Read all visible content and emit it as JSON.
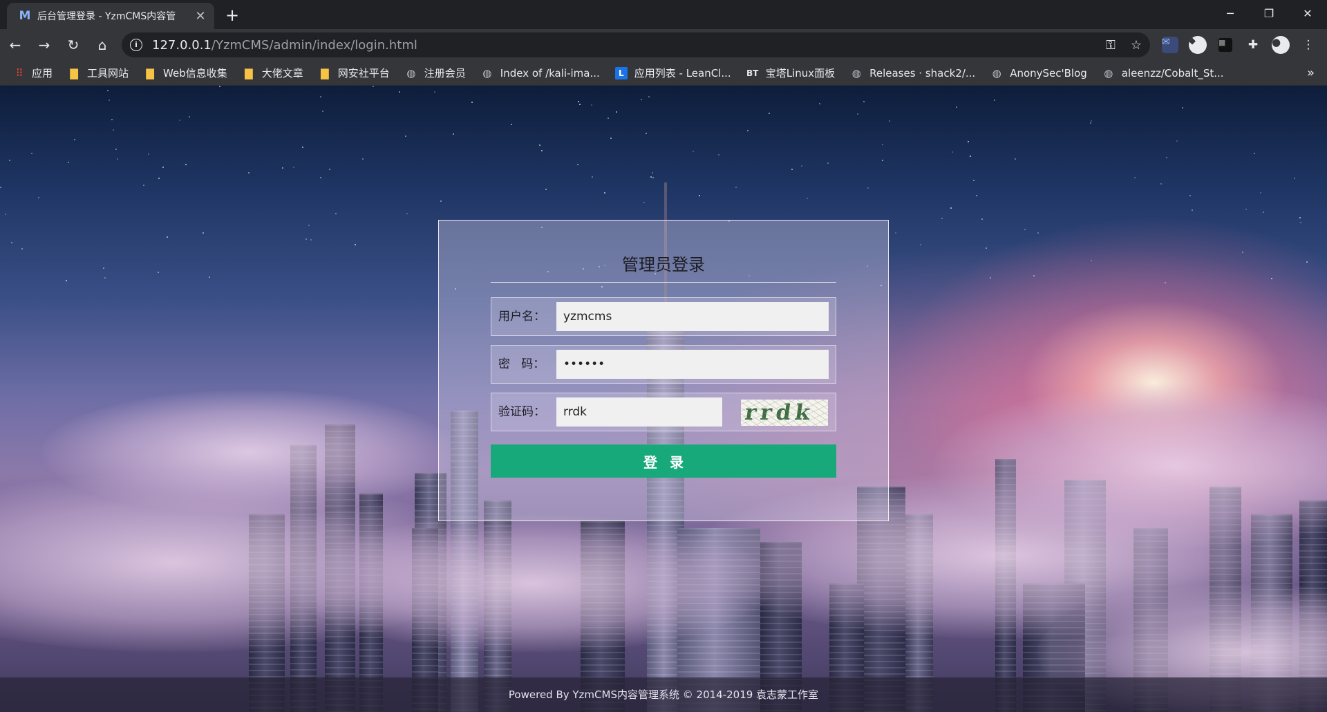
{
  "browser": {
    "tab_favicon": "M",
    "tab_title": "后台管理登录 - YzmCMS内容管",
    "tab_close": "✕",
    "new_tab": "+",
    "url_host": "127.0.0.1",
    "url_path": "/YzmCMS/admin/index/login.html",
    "window_controls": [
      "─",
      "❐",
      "✕"
    ],
    "bookmarks": [
      {
        "label": "应用",
        "icon": "apps-icon"
      },
      {
        "label": "工具网站",
        "icon": "folder-icon"
      },
      {
        "label": "Web信息收集",
        "icon": "folder-icon"
      },
      {
        "label": "大佬文章",
        "icon": "folder-icon"
      },
      {
        "label": "网安社平台",
        "icon": "folder-icon"
      },
      {
        "label": "注册会员",
        "icon": "globe-icon"
      },
      {
        "label": "Index of /kali-ima...",
        "icon": "globe-icon"
      },
      {
        "label": "应用列表 - LeanCl...",
        "icon": "leancloud-icon"
      },
      {
        "label": "宝塔Linux面板",
        "icon": "bt-icon"
      },
      {
        "label": "Releases · shack2/...",
        "icon": "globe-icon"
      },
      {
        "label": "AnonySec'Blog",
        "icon": "globe-icon"
      },
      {
        "label": "aleenzz/Cobalt_St...",
        "icon": "globe-icon"
      }
    ],
    "bookmarks_more": "»"
  },
  "login": {
    "title": "管理员登录",
    "username_label": "用户名：",
    "username_value": "yzmcms",
    "password_label": "密   码：",
    "password_value": "••••••",
    "captcha_label": "验证码：",
    "captcha_value": "rrdk",
    "captcha_image_text": "rrdk",
    "submit_label": "登录"
  },
  "footer": {
    "text": "Powered By YzmCMS内容管理系统 © 2014-2019 袁志蒙工作室"
  },
  "colors": {
    "submit_button": "#17a97a",
    "chrome_dark": "#202124",
    "chrome_toolbar": "#35363a"
  }
}
